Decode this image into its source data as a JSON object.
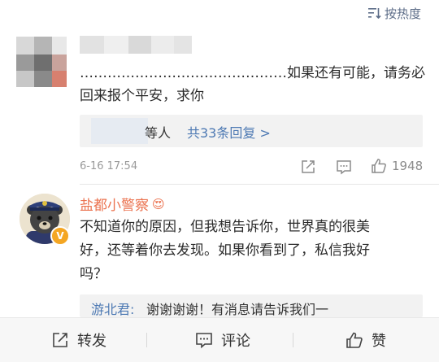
{
  "sort": {
    "label": "按热度"
  },
  "comment1": {
    "text_line1": "………………………………………如果还有可能，请务必",
    "text_line2": "回来报个平安，求你",
    "replies_from": "等人",
    "replies_link": "共33条回复 >",
    "time": "6-16 17:54",
    "likes": "1948"
  },
  "comment2": {
    "username": "盐都小警察",
    "emoji": "😍",
    "verified_badge": "V",
    "text_line1": "不知道你的原因，但我想告诉你，世界真的很美",
    "text_line2": "好，还等着你去发现。如果你看到了，私信我好",
    "text_line3": "吗？",
    "reply_author": "游北君:",
    "reply_text": "谢谢谢谢！有消息请告诉我们一"
  },
  "bottom": {
    "repost_label": "转发",
    "comment_label": "评论",
    "like_label": "赞"
  },
  "colors": {
    "link": "#4d79b3",
    "username": "#eb7350",
    "verified": "#f4a623"
  }
}
